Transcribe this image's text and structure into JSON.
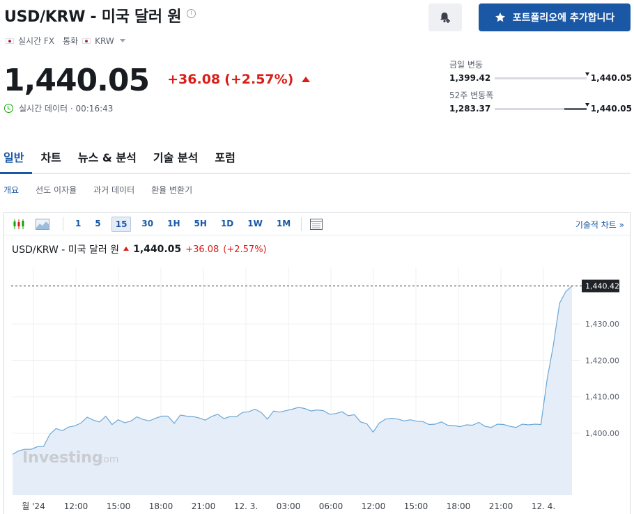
{
  "header": {
    "title": "USD/KRW - 미국 달러 원",
    "meta": {
      "realtime": "실시간 FX",
      "category": "통화",
      "currency": "KRW"
    },
    "portfolio_button": "포트폴리오에 추가합니다"
  },
  "quote": {
    "price": "1,440.05",
    "change": "+36.08",
    "change_pct": "(+2.57%)",
    "realtime_note": "실시간 데이터 · 00:16:43",
    "day_range": {
      "label": "금일 변동",
      "low": "1,399.42",
      "high": "1,440.05",
      "position": 0.99
    },
    "week52_range": {
      "label": "52주 변동폭",
      "low": "1,283.37",
      "high": "1,440.05",
      "position": 0.99,
      "fill_from": 0.76
    }
  },
  "tabs": [
    "일반",
    "차트",
    "뉴스 & 분석",
    "기술 분석",
    "포럼"
  ],
  "subtabs": [
    "개요",
    "선도 이자율",
    "과거 데이터",
    "환율 변환기"
  ],
  "chart_toolbar": {
    "periods": [
      "1",
      "5",
      "15",
      "30",
      "1H",
      "5H",
      "1D",
      "1W",
      "1M"
    ],
    "active_period": "15",
    "tech_link": "기술적 차트 »"
  },
  "chart_header": {
    "name": "USD/KRW - 미국 달러 원",
    "price": "1,440.05",
    "change": "+36.08",
    "change_pct": "(+2.57%)"
  },
  "watermark": {
    "brand": "Investing",
    "suffix": ".com"
  },
  "colors": {
    "accent": "#1a58a6",
    "down_red": "#d91e18",
    "line": "#6aa7d6",
    "fill": "#e5eef8"
  },
  "chart_data": {
    "type": "area",
    "title": "",
    "xlabel": "",
    "ylabel": "",
    "x_ticks": [
      "월 '24",
      "12:00",
      "15:00",
      "18:00",
      "21:00",
      "12. 3.",
      "03:00",
      "06:00",
      "12:00",
      "15:00",
      "18:00",
      "21:00",
      "12. 4."
    ],
    "y_ticks": [
      "1,400.00",
      "1,410.00",
      "1,420.00",
      "1,430.00"
    ],
    "y_tick_values": [
      1400,
      1410,
      1420,
      1430
    ],
    "ylim": [
      1383,
      1445.5
    ],
    "last_price_label": "1,440.42",
    "last_price": 1440.42,
    "grid": true,
    "values": [
      1394.2,
      1395.2,
      1395.6,
      1395.6,
      1396.3,
      1396.4,
      1399.7,
      1401.3,
      1400.7,
      1401.7,
      1402.0,
      1402.8,
      1404.4,
      1403.6,
      1403.1,
      1404.7,
      1402.4,
      1403.7,
      1402.9,
      1403.3,
      1404.5,
      1403.8,
      1403.4,
      1404.1,
      1404.7,
      1404.7,
      1402.7,
      1405.0,
      1404.7,
      1404.6,
      1404.2,
      1403.6,
      1404.6,
      1405.2,
      1404.0,
      1404.6,
      1404.5,
      1405.7,
      1405.9,
      1406.6,
      1405.7,
      1403.9,
      1406.1,
      1405.8,
      1406.2,
      1406.6,
      1407.1,
      1406.8,
      1406.1,
      1406.4,
      1406.2,
      1405.2,
      1405.4,
      1405.9,
      1404.8,
      1405.1,
      1403.1,
      1402.6,
      1400.3,
      1402.8,
      1403.9,
      1404.1,
      1403.9,
      1403.4,
      1403.7,
      1403.3,
      1403.2,
      1402.4,
      1402.5,
      1403.1,
      1402.2,
      1402.1,
      1401.8,
      1402.3,
      1402.2,
      1403.0,
      1401.9,
      1401.6,
      1402.5,
      1402.4,
      1401.9,
      1401.6,
      1402.5,
      1402.3,
      1402.5,
      1402.4,
      1414.8,
      1424.1,
      1435.7,
      1438.9,
      1440.4
    ]
  }
}
